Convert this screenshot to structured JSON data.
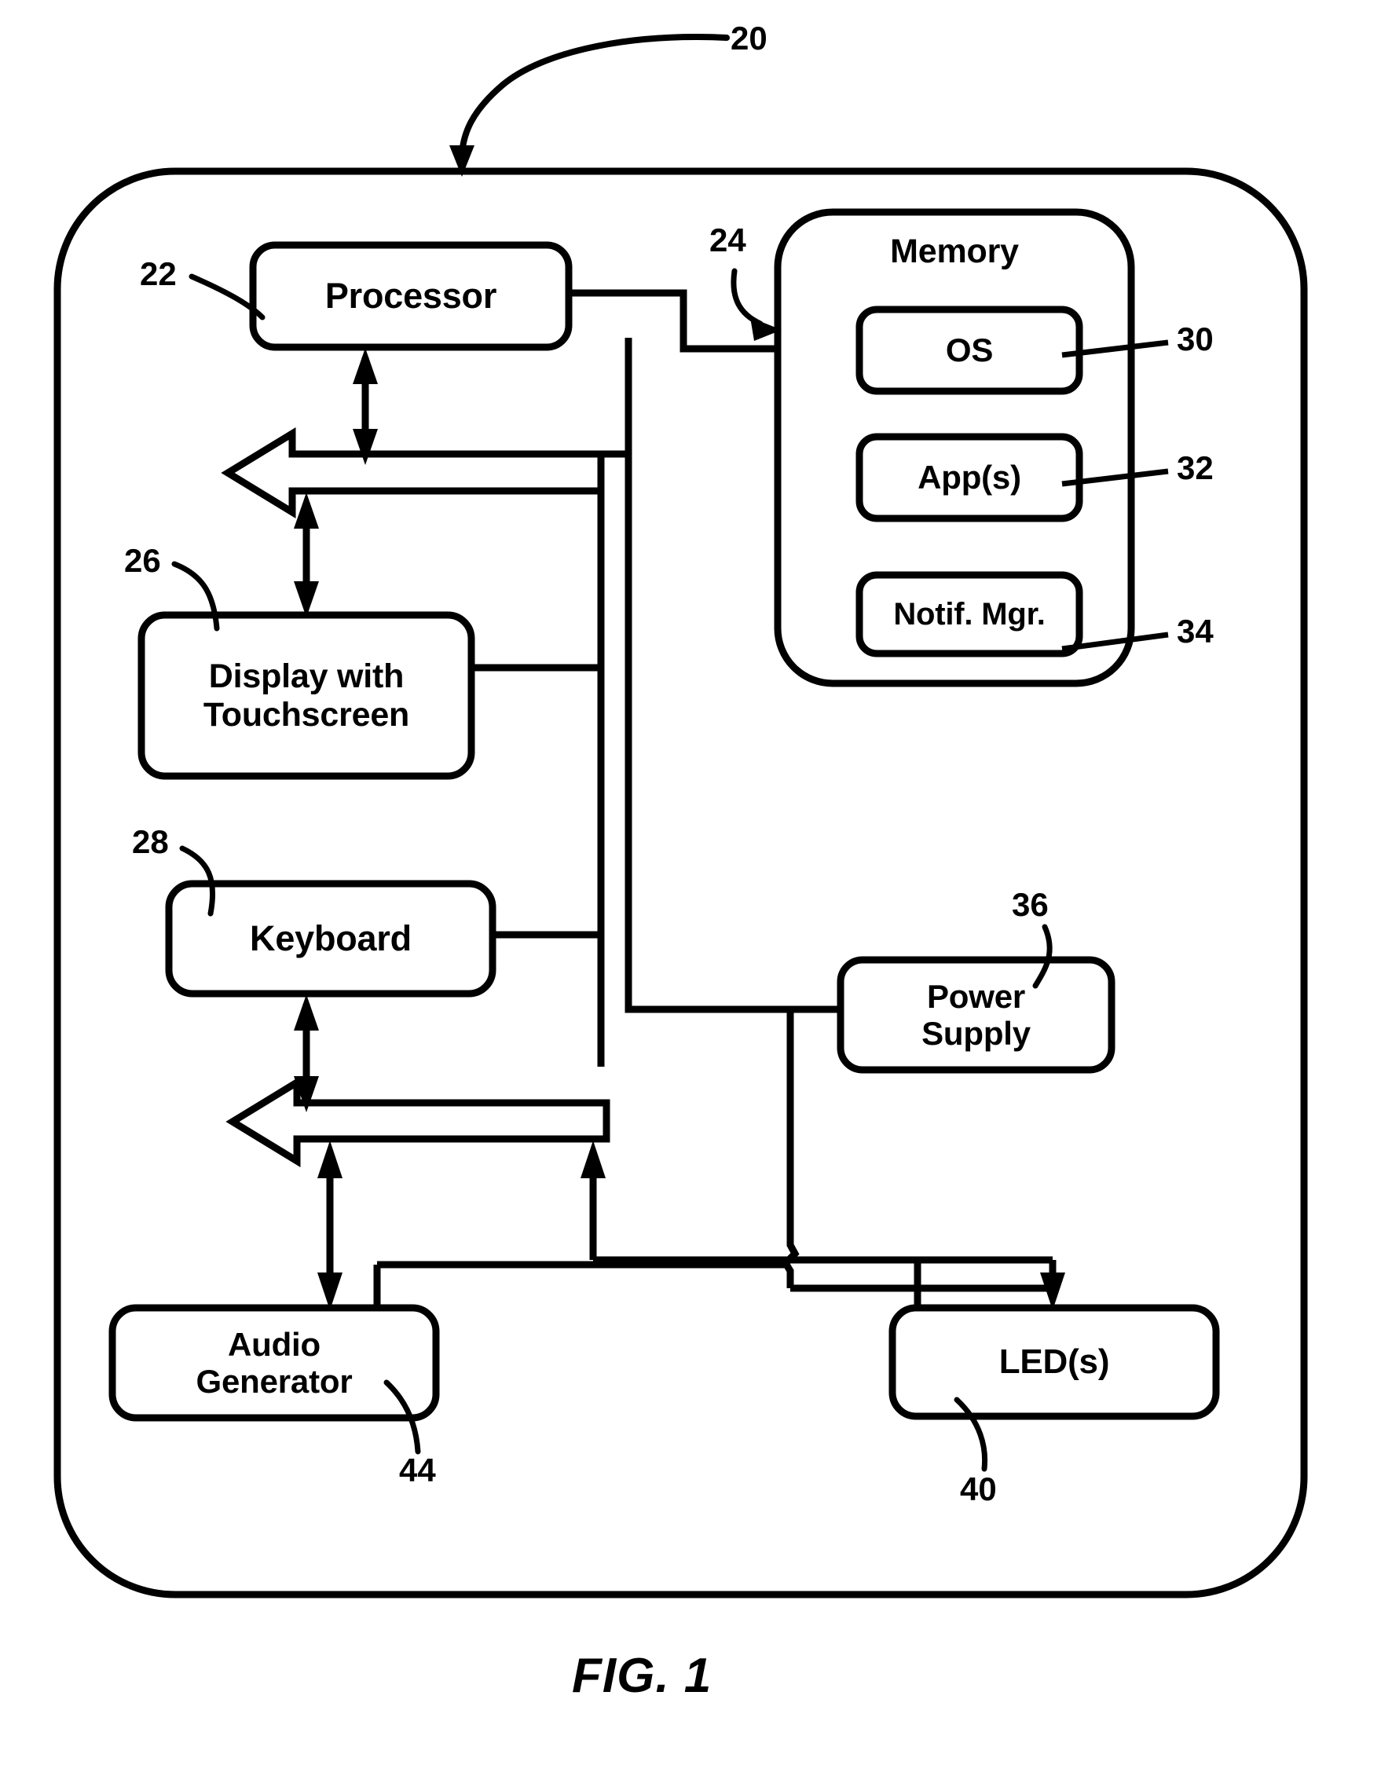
{
  "figure": {
    "caption": "FIG. 1",
    "device_label": "20",
    "blocks": {
      "processor": {
        "label": "Processor",
        "ref": "22"
      },
      "memory": {
        "label": "Memory",
        "ref": "24"
      },
      "os": {
        "label": "OS",
        "ref": "30"
      },
      "apps": {
        "label": "App(s)",
        "ref": "32"
      },
      "notif_mgr": {
        "label": "Notif. Mgr.",
        "ref": "34"
      },
      "display": {
        "label": "Display with\nTouchscreen",
        "ref": "26"
      },
      "keyboard": {
        "label": "Keyboard",
        "ref": "28"
      },
      "power": {
        "label": "Power\nSupply",
        "ref": "36"
      },
      "audio": {
        "label": "Audio\nGenerator",
        "ref": "44"
      },
      "led": {
        "label": "LED(s)",
        "ref": "40"
      }
    },
    "colors": {
      "line": "#000000",
      "background": "#ffffff"
    }
  }
}
